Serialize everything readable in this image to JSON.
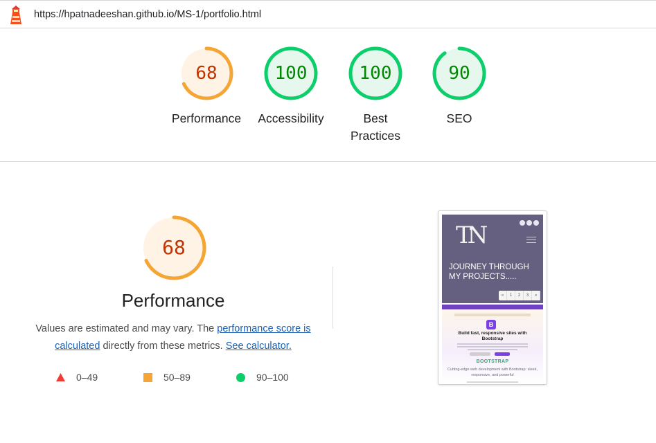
{
  "header": {
    "url": "https://hpatnadeeshan.github.io/MS-1/portfolio.html",
    "logo_icon": "lighthouse-icon"
  },
  "colors": {
    "pass": "#0cce6b",
    "pass_text": "#008800",
    "pass_bg": "#e6f8ee",
    "average": "#f4a534",
    "average_text": "#c33300",
    "average_bg": "#fff3e6",
    "fail": "#f33b35",
    "link": "#1a5fb4"
  },
  "scores": [
    {
      "score": 68,
      "label": "Performance",
      "rating": "average"
    },
    {
      "score": 100,
      "label": "Accessibility",
      "rating": "pass"
    },
    {
      "score": 100,
      "label": "Best Practices",
      "rating": "pass"
    },
    {
      "score": 90,
      "label": "SEO",
      "rating": "pass"
    }
  ],
  "performance": {
    "score": 68,
    "title": "Performance",
    "desc_prefix": "Values are estimated and may vary. The ",
    "desc_link_score": "performance score is calculated",
    "desc_middle": " directly from these metrics. ",
    "desc_link_calc": "See calculator."
  },
  "legend": [
    {
      "shape": "triangle-icon",
      "range": "0–49"
    },
    {
      "shape": "square-icon",
      "range": "50–89"
    },
    {
      "shape": "circle-icon",
      "range": "90–100"
    }
  ],
  "screenshot": {
    "brand": "TN",
    "heading": "JOURNEY THROUGH MY PROJECTS.....",
    "pager": [
      "«",
      "1",
      "2",
      "3",
      "»"
    ],
    "promo_headline": "Build fast, responsive sites with Bootstrap",
    "promo_icon": "B",
    "promo_name": "BOOTSTRAP",
    "promo_tagline": "Cutting-edge web development with Bootstrap: sleek, responsive, and powerful"
  }
}
